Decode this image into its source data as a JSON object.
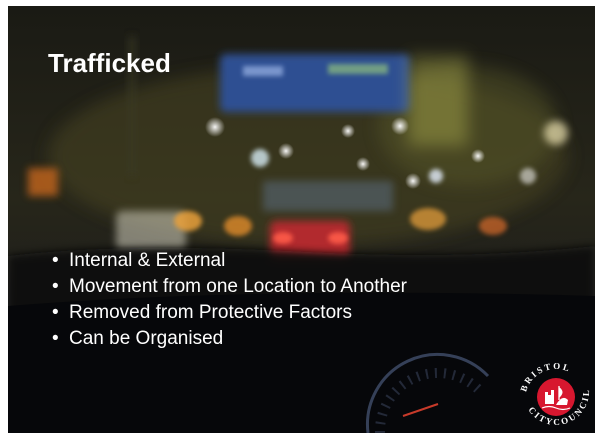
{
  "slide": {
    "title": "Trafficked",
    "bullet_glyph": "•",
    "bullets": [
      "Internal & External",
      "Movement from one Location to Another",
      "Removed from Protective Factors",
      "Can be Organised"
    ],
    "background_image": "blurred night road through rainy windscreen",
    "logo": {
      "name": "bristol-city-council-logo",
      "text": "BRISTOL CITY COUNCIL",
      "color": "#d7172f"
    }
  }
}
